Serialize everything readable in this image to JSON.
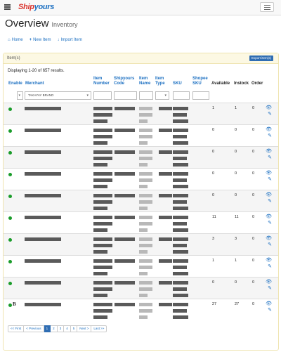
{
  "app": {
    "logo_part1": "Ship",
    "logo_part2": "yours"
  },
  "page": {
    "title": "Overview",
    "subtitle": "Inventory"
  },
  "actions": [
    {
      "icon": "home-icon",
      "label": "Home"
    },
    {
      "icon": "plus-icon",
      "label": "New Item"
    },
    {
      "icon": "download-icon",
      "label": "Import Item"
    }
  ],
  "panel": {
    "heading": "Item(s)",
    "export_label": "Export item(s)",
    "summary": "Displaying 1-20 of 657 results."
  },
  "table": {
    "headers": {
      "enable": "Enable",
      "merchant": "Merchant",
      "item_number": "Item Number",
      "shipyours_code": "Shipyours Code",
      "item_name": "Item Name",
      "item_type": "Item Type",
      "sku": "SKU",
      "shopee_sku": "Shopee SKU",
      "available": "Available",
      "instock": "Instock",
      "order": "Order"
    },
    "filter_merchant": "TAKAYAY BRAND",
    "rows": [
      {
        "available": "1",
        "instock": "1",
        "order": "0",
        "mark": ""
      },
      {
        "available": "0",
        "instock": "0",
        "order": "0",
        "mark": ""
      },
      {
        "available": "0",
        "instock": "0",
        "order": "0",
        "mark": ""
      },
      {
        "available": "0",
        "instock": "0",
        "order": "0",
        "mark": ""
      },
      {
        "available": "0",
        "instock": "0",
        "order": "0",
        "mark": ""
      },
      {
        "available": "11",
        "instock": "11",
        "order": "0",
        "mark": ""
      },
      {
        "available": "3",
        "instock": "3",
        "order": "0",
        "mark": ""
      },
      {
        "available": "1",
        "instock": "1",
        "order": "0",
        "mark": ""
      },
      {
        "available": "0",
        "instock": "0",
        "order": "0",
        "mark": ""
      },
      {
        "available": "27",
        "instock": "27",
        "order": "0",
        "mark": "B"
      }
    ]
  },
  "pager": {
    "first": "<< First",
    "prev": "< Previous",
    "pages": [
      "1",
      "2",
      "3",
      "4",
      "5"
    ],
    "next": "Next >",
    "last": "Last >>"
  },
  "colors": {
    "accent": "#1b6fc1",
    "enabled": "#1a9c2a",
    "panel_head": "#fcf8e3"
  }
}
